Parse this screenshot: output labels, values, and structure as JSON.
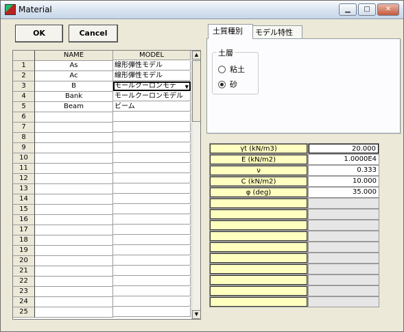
{
  "window": {
    "title": "Material",
    "minimize": "▁",
    "maximize": "□",
    "close": "✕"
  },
  "buttons": {
    "ok": "OK",
    "cancel": "Cancel"
  },
  "grid": {
    "headers": {
      "name": "NAME",
      "model": "MODEL"
    },
    "rows": [
      {
        "num": "1",
        "name": "As",
        "model": "線形弾性モデル"
      },
      {
        "num": "2",
        "name": "Ac",
        "model": "線形弾性モデル"
      },
      {
        "num": "3",
        "name": "B",
        "model": "モールクーロンモデ"
      },
      {
        "num": "4",
        "name": "Bank",
        "model": "モールクーロンモデル"
      },
      {
        "num": "5",
        "name": "Beam",
        "model": "ビーム"
      },
      {
        "num": "6",
        "name": "",
        "model": ""
      },
      {
        "num": "7",
        "name": "",
        "model": ""
      },
      {
        "num": "8",
        "name": "",
        "model": ""
      },
      {
        "num": "9",
        "name": "",
        "model": ""
      },
      {
        "num": "10",
        "name": "",
        "model": ""
      },
      {
        "num": "11",
        "name": "",
        "model": ""
      },
      {
        "num": "12",
        "name": "",
        "model": ""
      },
      {
        "num": "13",
        "name": "",
        "model": ""
      },
      {
        "num": "14",
        "name": "",
        "model": ""
      },
      {
        "num": "15",
        "name": "",
        "model": ""
      },
      {
        "num": "16",
        "name": "",
        "model": ""
      },
      {
        "num": "17",
        "name": "",
        "model": ""
      },
      {
        "num": "18",
        "name": "",
        "model": ""
      },
      {
        "num": "19",
        "name": "",
        "model": ""
      },
      {
        "num": "20",
        "name": "",
        "model": ""
      },
      {
        "num": "21",
        "name": "",
        "model": ""
      },
      {
        "num": "22",
        "name": "",
        "model": ""
      },
      {
        "num": "23",
        "name": "",
        "model": ""
      },
      {
        "num": "24",
        "name": "",
        "model": ""
      },
      {
        "num": "25",
        "name": "",
        "model": ""
      }
    ]
  },
  "tabs": {
    "soil_type": "土質種別",
    "model_props": "モデル特性"
  },
  "soil_group": {
    "label": "土層",
    "clay": "粘土",
    "sand": "砂",
    "selected": "sand"
  },
  "params": [
    {
      "label": "γt (kN/m3)",
      "value": "20.000"
    },
    {
      "label": "E (kN/m2)",
      "value": "1.0000E4"
    },
    {
      "label": "ν",
      "value": "0.333"
    },
    {
      "label": "C (kN/m2)",
      "value": "10.000"
    },
    {
      "label": "φ (deg)",
      "value": "35.000"
    },
    {
      "label": "",
      "value": ""
    },
    {
      "label": "",
      "value": ""
    },
    {
      "label": "",
      "value": ""
    },
    {
      "label": "",
      "value": ""
    },
    {
      "label": "",
      "value": ""
    },
    {
      "label": "",
      "value": ""
    },
    {
      "label": "",
      "value": ""
    },
    {
      "label": "",
      "value": ""
    },
    {
      "label": "",
      "value": ""
    },
    {
      "label": "",
      "value": ""
    }
  ]
}
